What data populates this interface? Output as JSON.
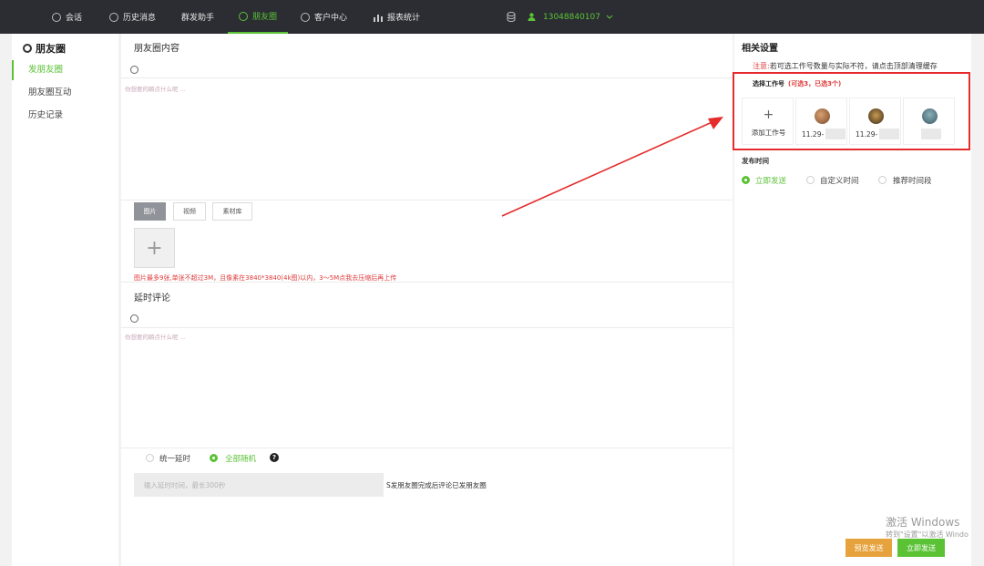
{
  "topnav": {
    "items": [
      {
        "label": "会话",
        "icon": "chat-icon"
      },
      {
        "label": "历史消息",
        "icon": "clock-icon"
      },
      {
        "label": "群发助手",
        "icon": ""
      },
      {
        "label": "朋友圈",
        "icon": "moments-icon",
        "active": true
      },
      {
        "label": "客户中心",
        "icon": "user-icon"
      },
      {
        "label": "报表统计",
        "icon": "bar-chart-icon"
      }
    ],
    "account": "13048840107"
  },
  "sidebar": {
    "title": "朋友圈",
    "items": [
      {
        "label": "发朋友圈",
        "active": true
      },
      {
        "label": "朋友圈互动"
      },
      {
        "label": "历史记录"
      }
    ]
  },
  "main": {
    "content_title": "朋友圈内容",
    "content_placeholder": "你想要的瞬点什么呢 ...",
    "media_tabs": [
      "图片",
      "视频",
      "素材库"
    ],
    "upload_warning": "图片最多9张,单张不超过3M，且像素在3840*3840(4k图)以内，3～5M点我去压缩后再上传",
    "comment_title": "延时评论",
    "comment_placeholder": "你想要的瞬点什么呢 ...",
    "delay_options": [
      "统一延时",
      "全部随机"
    ],
    "delay_selected": "全部随机",
    "delay_placeholder": "输入延时时间，最长300秒",
    "delay_note": "S发朋友圈完成后评论已发朋友圈"
  },
  "settings": {
    "title": "相关设置",
    "notice_prefix": "注意:",
    "notice_text": "若可选工作号数量与实际不符，请点击顶部清理缓存",
    "select_label": "选择工作号",
    "select_count": "(可选3，已选3个)",
    "add_label": "添加工作号",
    "accounts": [
      {
        "number": "11.29-",
        "avatar_color": "#8a5a3c"
      },
      {
        "number": "11.29-",
        "avatar_color": "#6b4a2a"
      },
      {
        "number": "",
        "avatar_color": "#4a7a86"
      }
    ],
    "publish_label": "发布时间",
    "publish_options": [
      "立即发送",
      "自定义时间",
      "推荐时间段"
    ],
    "publish_selected": "立即发送"
  },
  "actions": {
    "preview_label": "预览发送",
    "send_label": "立即发送",
    "preview_color": "#e6a23c",
    "send_color": "#5bc236"
  },
  "watermark": {
    "line1": "激活 Windows",
    "line2": "转到\"设置\"以激活 Windo"
  },
  "annotation_color": "#e52b2b"
}
